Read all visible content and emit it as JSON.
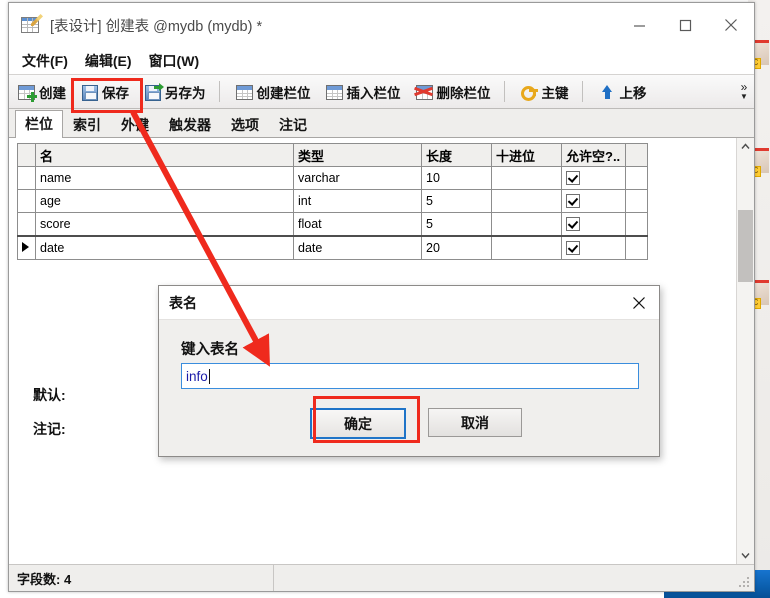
{
  "window": {
    "title": "[表设计] 创建表 @mydb (mydb) *",
    "app_icon": "table-design-icon",
    "controls": {
      "minimize": "minimize-icon",
      "maximize": "maximize-icon",
      "close": "close-icon"
    }
  },
  "menubar": {
    "items": [
      {
        "label": "文件(F)",
        "text": "文件",
        "mnemonic": "F"
      },
      {
        "label": "编辑(E)",
        "text": "编辑",
        "mnemonic": "E"
      },
      {
        "label": "窗口(W)",
        "text": "窗口",
        "mnemonic": "W"
      }
    ]
  },
  "toolbar": {
    "items": [
      {
        "label": "创建",
        "icon": "table-new-icon"
      },
      {
        "label": "保存",
        "icon": "save-floppy-icon",
        "highlighted": true
      },
      {
        "label": "另存为",
        "icon": "save-as-icon"
      },
      {
        "label": "创建栏位",
        "icon": "column-new-icon"
      },
      {
        "label": "插入栏位",
        "icon": "column-insert-icon"
      },
      {
        "label": "删除栏位",
        "icon": "column-delete-icon"
      },
      {
        "label": "主键",
        "icon": "primary-key-icon"
      },
      {
        "label": "上移",
        "icon": "move-up-icon"
      }
    ],
    "overflow": "»"
  },
  "tabs": [
    {
      "label": "栏位",
      "active": true
    },
    {
      "label": "索引",
      "active": false
    },
    {
      "label": "外键",
      "active": false
    },
    {
      "label": "触发器",
      "active": false
    },
    {
      "label": "选项",
      "active": false
    },
    {
      "label": "注记",
      "active": false
    }
  ],
  "grid": {
    "columns": [
      "名",
      "类型",
      "长度",
      "十进位",
      "允许空?.."
    ],
    "rows": [
      {
        "name": "name",
        "type": "varchar",
        "length": "10",
        "decimals": "",
        "nullable": true,
        "current": false
      },
      {
        "name": "age",
        "type": "int",
        "length": "5",
        "decimals": "",
        "nullable": true,
        "current": false
      },
      {
        "name": "score",
        "type": "float",
        "length": "5",
        "decimals": "",
        "nullable": true,
        "current": false
      },
      {
        "name": "date",
        "type": "date",
        "length": "20",
        "decimals": "",
        "nullable": true,
        "current": true
      }
    ]
  },
  "properties": {
    "default_label": "默认:",
    "default_value": "",
    "comment_label": "注记:",
    "comment_value": ""
  },
  "scrollbar": {
    "up": "▲",
    "down": "▼"
  },
  "statusbar": {
    "field_count": "字段数: 4",
    "right_pane": ""
  },
  "dialog": {
    "title": "表名",
    "close_icon": "close-icon",
    "input_label": "键入表名",
    "input_value": "info",
    "input_placeholder": "",
    "ok_label": "确定",
    "cancel_label": "取消",
    "ok_highlighted": true
  },
  "annotations": {
    "color": "#ef2a1d",
    "boxes": [
      "save-button",
      "ok-button"
    ],
    "arrow": "from 保存 toolbar button to 表名 dialog input"
  }
}
